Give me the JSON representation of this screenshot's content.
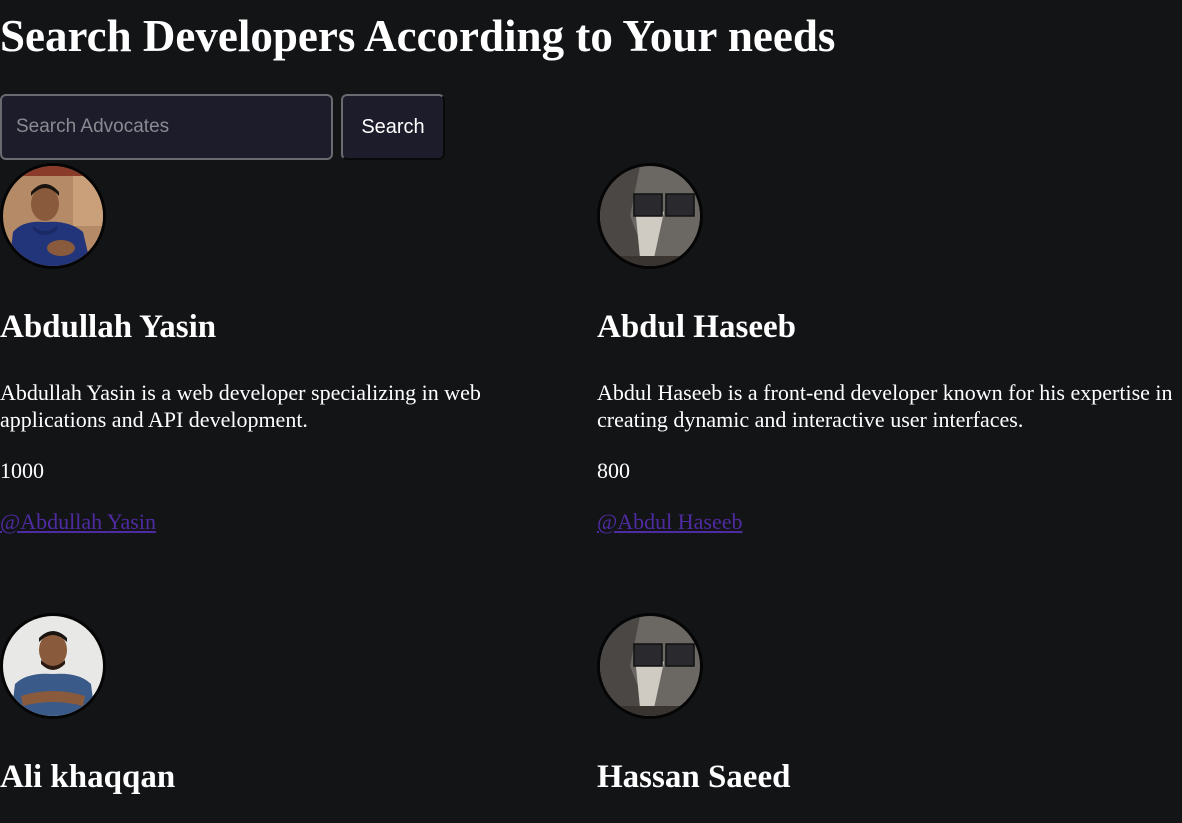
{
  "header": {
    "title": "Search Developers According to Your needs"
  },
  "search": {
    "placeholder": "Search Advocates",
    "value": "",
    "button_label": "Search"
  },
  "developers": [
    {
      "name": "Abdullah Yasin",
      "description": "Abdullah Yasin is a web developer specializing in web applications and API development.",
      "rate": "1000",
      "handle": "@Abdullah Yasin",
      "avatar_icon": "person-photo-icon"
    },
    {
      "name": "Abdul Haseeb",
      "description": "Abdul Haseeb is a front-end developer known for his expertise in creating dynamic and interactive user interfaces.",
      "rate": "800",
      "handle": "@Abdul Haseeb",
      "avatar_icon": "placeholder-photo-icon"
    },
    {
      "name": "Ali khaqqan",
      "avatar_icon": "person-photo-icon"
    },
    {
      "name": "Hassan Saeed",
      "avatar_icon": "placeholder-photo-icon"
    }
  ],
  "colors": {
    "background": "#131416",
    "input_background": "#1d1c2b",
    "link": "#4f2ba3",
    "text": "#ffffff"
  }
}
